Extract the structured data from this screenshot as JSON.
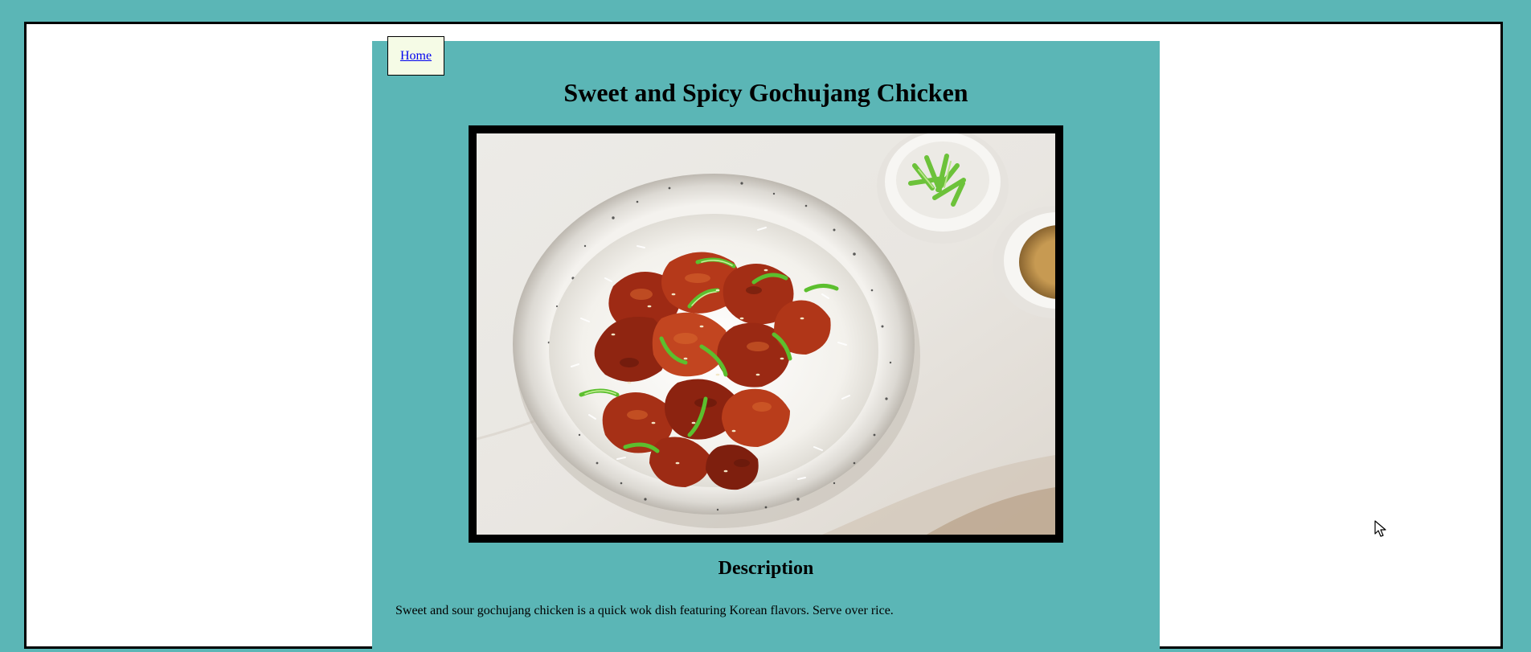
{
  "nav": {
    "home_label": "Home"
  },
  "recipe": {
    "title": "Sweet and Spicy Gochujang Chicken",
    "image_alt": "Bowl of gochujang chicken over white rice topped with sliced green onions and sesame seeds",
    "description_heading": "Description",
    "description_text": "Sweet and sour gochujang chicken is a quick wok dish featuring Korean flavors. Serve over rice."
  },
  "colors": {
    "page_background": "#5bb6b6",
    "frame_background": "#ffffff",
    "home_box_background": "#f5fbe6",
    "link": "#0000ee",
    "photo_border": "#000000"
  },
  "icons": {
    "cursor": "mouse-pointer-icon"
  }
}
